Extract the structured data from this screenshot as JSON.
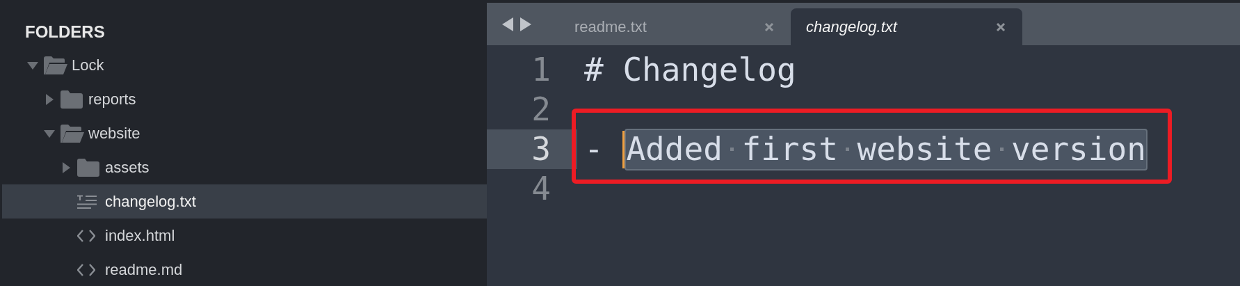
{
  "sidebar": {
    "heading": "FOLDERS",
    "tree": [
      {
        "label": "Lock",
        "kind": "folder",
        "expanded": true,
        "selected": false,
        "children": [
          {
            "label": "reports",
            "kind": "folder",
            "expanded": false,
            "selected": false
          },
          {
            "label": "website",
            "kind": "folder",
            "expanded": true,
            "selected": false,
            "children": [
              {
                "label": "assets",
                "kind": "folder",
                "expanded": false,
                "selected": false
              },
              {
                "label": "changelog.txt",
                "kind": "text",
                "selected": true
              },
              {
                "label": "index.html",
                "kind": "code",
                "selected": false
              },
              {
                "label": "readme.md",
                "kind": "code",
                "selected": false
              }
            ]
          }
        ]
      }
    ]
  },
  "tabs": [
    {
      "label": "readme.txt",
      "selected": false
    },
    {
      "label": "changelog.txt",
      "selected": true
    }
  ],
  "editor": {
    "lines": [
      {
        "number": "1",
        "text": "# Changelog",
        "current": false,
        "annotated": false
      },
      {
        "number": "2",
        "current": false,
        "annotated": false
      },
      {
        "number": "3",
        "text": "- ",
        "selected_text": "Added first website version",
        "current": true,
        "annotated": true
      },
      {
        "number": "4",
        "current": false,
        "annotated": false
      }
    ]
  }
}
